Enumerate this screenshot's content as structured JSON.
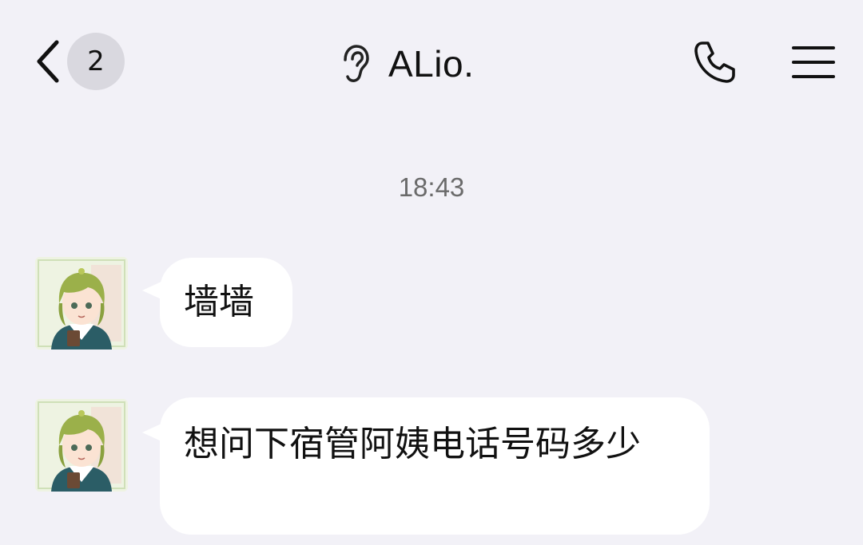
{
  "header": {
    "back_icon": "chevron-left-icon",
    "unread_count": "2",
    "ear_icon": "ear-icon",
    "title": "ALio.",
    "phone_icon": "phone-icon",
    "menu_icon": "hamburger-menu-icon"
  },
  "chat": {
    "timestamp": "18:43",
    "messages": [
      {
        "sender": "other",
        "avatar": "anime-avatar-green-hair",
        "text": "墙墙"
      },
      {
        "sender": "other",
        "avatar": "anime-avatar-green-hair",
        "text": "想问下宿管阿姨电话号码多少"
      }
    ]
  },
  "colors": {
    "background": "#f2f1f7",
    "bubble": "#ffffff",
    "badge": "#d9d8df",
    "timestamp": "#6b6b6b"
  }
}
